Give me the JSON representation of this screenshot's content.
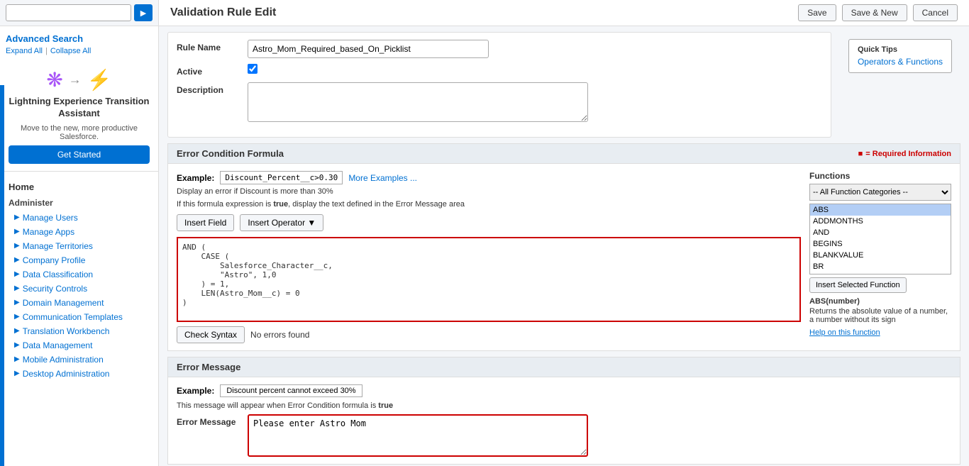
{
  "sidebar": {
    "search_placeholder": "",
    "advanced_search_label": "Advanced Search",
    "expand_label": "Expand All",
    "collapse_label": "Collapse All",
    "promo": {
      "title": "Lightning Experience Transition Assistant",
      "description": "Move to the new, more productive Salesforce.",
      "button_label": "Get Started"
    },
    "nav": {
      "home_label": "Home",
      "administer_label": "Administer",
      "items": [
        {
          "label": "Manage Users"
        },
        {
          "label": "Manage Apps"
        },
        {
          "label": "Manage Territories"
        },
        {
          "label": "Company Profile"
        },
        {
          "label": "Data Classification"
        },
        {
          "label": "Security Controls"
        },
        {
          "label": "Domain Management"
        },
        {
          "label": "Communication Templates"
        },
        {
          "label": "Translation Workbench"
        },
        {
          "label": "Data Management"
        },
        {
          "label": "Mobile Administration"
        },
        {
          "label": "Desktop Administration"
        }
      ]
    }
  },
  "toolbar": {
    "title": "Validation Rule Edit",
    "save_label": "Save",
    "save_new_label": "Save & New",
    "cancel_label": "Cancel"
  },
  "form": {
    "rule_name_label": "Rule Name",
    "rule_name_value": "Astro_Mom_Required_based_On_Picklist",
    "active_label": "Active",
    "active_checked": true,
    "description_label": "Description",
    "description_value": ""
  },
  "quick_tips": {
    "title": "Quick Tips",
    "link_label": "Operators & Functions"
  },
  "formula_section": {
    "title": "Error Condition Formula",
    "required_note": "= Required Information",
    "example_label": "Example:",
    "example_code": "Discount_Percent__c>0.30",
    "more_examples_link": "More Examples ...",
    "example_desc": "Display an error if Discount is more than 30%",
    "formula_note": "If this formula expression is true, display the text defined in the Error Message area",
    "insert_field_label": "Insert Field",
    "insert_operator_label": "Insert Operator ▼",
    "formula_code": "AND (\n    CASE (\n        Salesforce_Character__c,\n        \"Astro\", 1,0\n    ) = 1,\n    LEN(Astro_Mom__c) = 0\n)",
    "check_syntax_label": "Check Syntax",
    "syntax_result": "No errors found",
    "functions_title": "Functions",
    "functions_dropdown": "-- All Function Categories --",
    "function_items": [
      {
        "name": "ABS",
        "selected": true
      },
      {
        "name": "ADDMONTHS"
      },
      {
        "name": "AND"
      },
      {
        "name": "BEGINS"
      },
      {
        "name": "BLANKVALUE"
      },
      {
        "name": "BR"
      }
    ],
    "insert_fn_label": "Insert Selected Function",
    "fn_signature": "ABS(number)",
    "fn_desc": "Returns the absolute value of a number, a number without its sign",
    "fn_help_link": "Help on this function"
  },
  "error_message_section": {
    "title": "Error Message",
    "example_label": "Example:",
    "example_code": "Discount percent cannot exceed 30%",
    "note": "This message will appear when Error Condition formula is true",
    "error_msg_label": "Error Message",
    "error_msg_value": "Please enter Astro Mom"
  }
}
